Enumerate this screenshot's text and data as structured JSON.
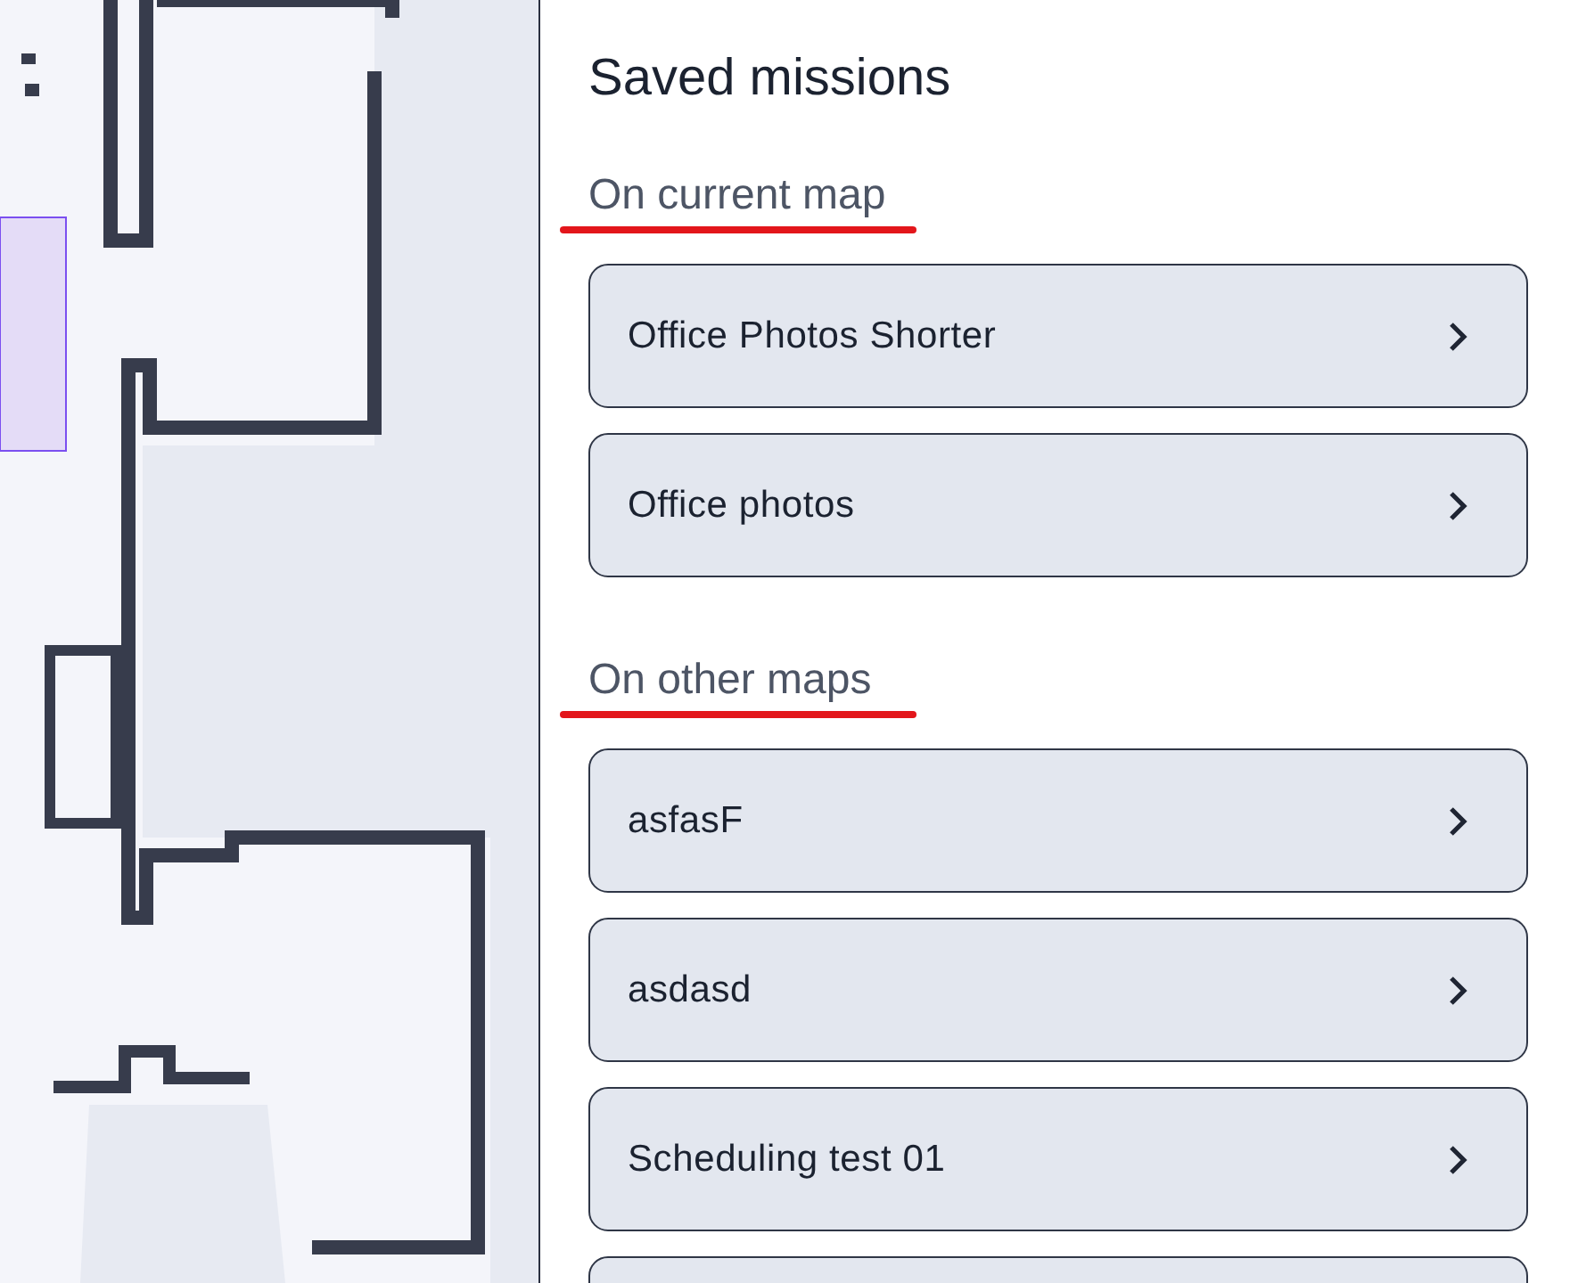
{
  "panel": {
    "title": "Saved missions",
    "sections": [
      {
        "heading": "On current map",
        "missions": [
          {
            "name": "Office Photos Shorter"
          },
          {
            "name": "Office photos"
          }
        ]
      },
      {
        "heading": "On other maps",
        "missions": [
          {
            "name": "asfasF"
          },
          {
            "name": "asdasd"
          },
          {
            "name": "Scheduling test 01"
          }
        ]
      }
    ]
  }
}
